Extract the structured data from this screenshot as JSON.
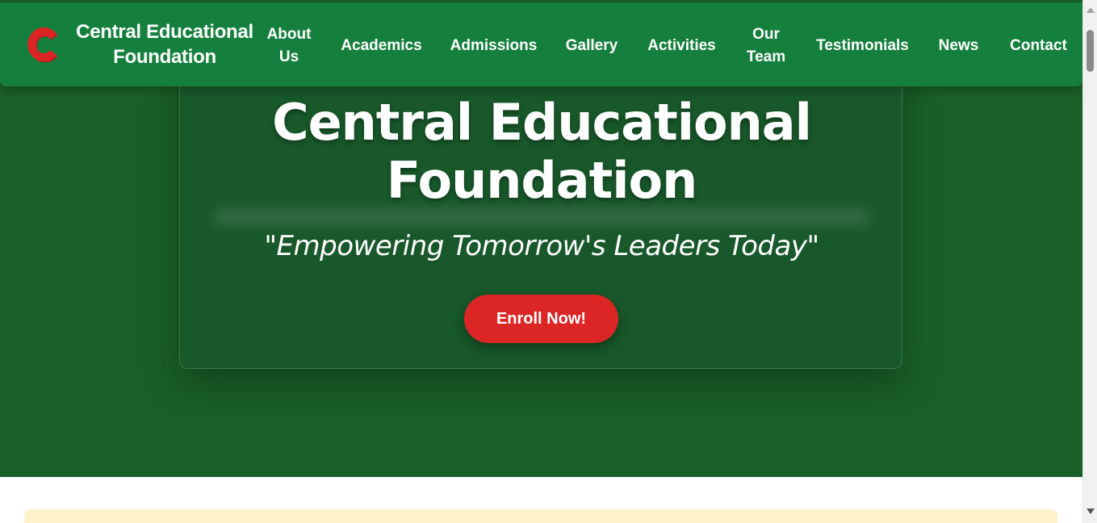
{
  "navbar": {
    "logo_icon": "c-logo-icon",
    "brand_lines": [
      "Central Educational",
      "Foundation"
    ],
    "items": [
      {
        "lines": [
          "About",
          "Us"
        ]
      },
      {
        "label": "Academics"
      },
      {
        "label": "Admissions"
      },
      {
        "label": "Gallery"
      },
      {
        "label": "Activities"
      },
      {
        "lines": [
          "Our",
          "Team"
        ]
      },
      {
        "label": "Testimonials"
      },
      {
        "label": "News"
      },
      {
        "label": "Contact"
      }
    ]
  },
  "hero": {
    "title_lines": [
      "Central Educational",
      "Foundation"
    ],
    "tagline": "\"Empowering Tomorrow's Leaders Today\"",
    "cta_label": "Enroll Now!"
  },
  "colors": {
    "navbar_bg": "#15803d",
    "hero_bg": "#1a5f28",
    "cta_bg": "#dc2626",
    "logo": "#dc2626",
    "notice_bg": "#fdf2c8"
  }
}
